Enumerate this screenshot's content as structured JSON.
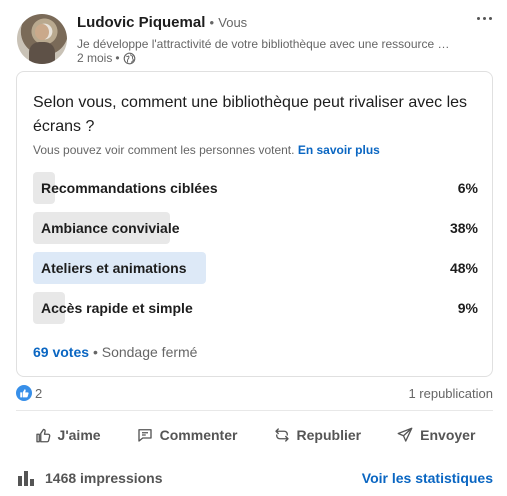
{
  "post": {
    "author": {
      "name": "Ludovic Piquemal",
      "separator": "•",
      "relation": "Vous"
    },
    "headline": "Je développe l'attractivité de votre bibliothèque avec une ressource …",
    "time": "2 mois",
    "time_separator": "•",
    "visibility_icon": "globe-icon",
    "more_icon": "more-options-icon"
  },
  "poll": {
    "question": "Selon vous, comment une bibliothèque peut rivaliser avec les écrans ?",
    "visibility_text": "Vous pouvez voir comment les personnes votent.",
    "learn_more": "En savoir plus",
    "options": [
      {
        "label": "Recommandations ciblées",
        "percent_label": "6%",
        "percent": 6,
        "winner": false
      },
      {
        "label": "Ambiance conviviale",
        "percent_label": "38%",
        "percent": 38,
        "winner": false
      },
      {
        "label": "Ateliers et animations",
        "percent_label": "48%",
        "percent": 48,
        "winner": true
      },
      {
        "label": "Accès rapide et simple",
        "percent_label": "9%",
        "percent": 9,
        "winner": false
      }
    ],
    "votes": "69 votes",
    "status_separator": "•",
    "status": "Sondage fermé"
  },
  "social": {
    "reaction_icon": "like-icon",
    "reactions_count": "2",
    "reposts": "1 republication"
  },
  "actions": [
    {
      "label": "J'aime",
      "icon": "thumbs-up-icon"
    },
    {
      "label": "Commenter",
      "icon": "comment-icon"
    },
    {
      "label": "Republier",
      "icon": "repost-icon"
    },
    {
      "label": "Envoyer",
      "icon": "send-icon"
    }
  ],
  "impressions": {
    "icon": "bar-chart-icon",
    "text": "1468 impressions",
    "stats_link": "Voir les statistiques"
  },
  "colors": {
    "link": "#0a66c2",
    "winner_bar": "#dde9f7",
    "option_bar": "#e8e8e8",
    "like_badge": "#378fe9",
    "muted_text": "#666666"
  }
}
